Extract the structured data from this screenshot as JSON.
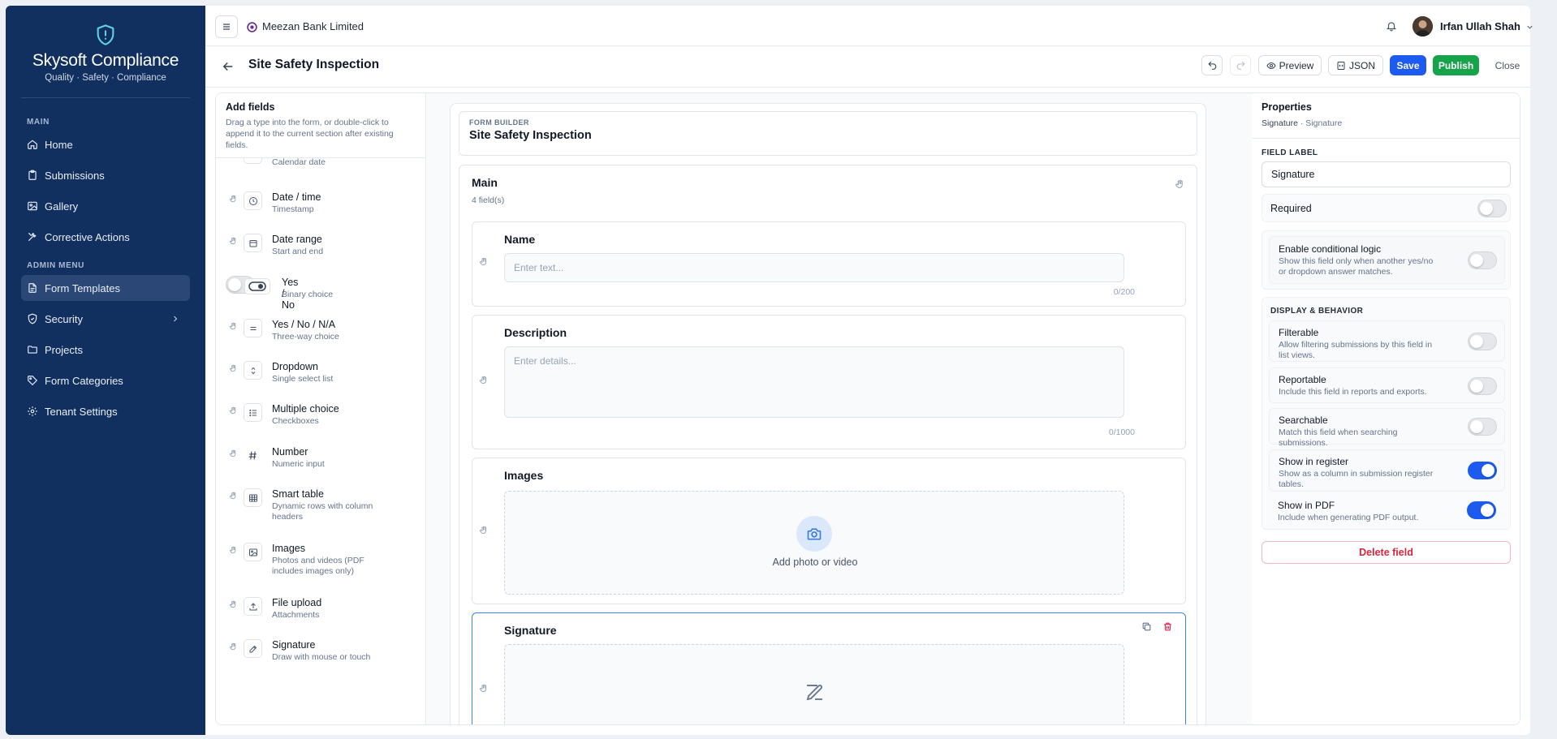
{
  "brand": {
    "title": "Skysoft Compliance",
    "subtitle": "Quality · Safety · Compliance"
  },
  "sidebar": {
    "main_heading": "MAIN",
    "main_items": [
      {
        "label": "Home",
        "icon": "home-icon"
      },
      {
        "label": "Submissions",
        "icon": "clipboard-icon"
      },
      {
        "label": "Gallery",
        "icon": "image-icon"
      },
      {
        "label": "Corrective Actions",
        "icon": "tools-icon"
      }
    ],
    "admin_heading": "ADMIN MENU",
    "admin_items": [
      {
        "label": "Form Templates",
        "icon": "file-icon",
        "active": true
      },
      {
        "label": "Security",
        "icon": "shield-icon",
        "has_submenu": true
      },
      {
        "label": "Projects",
        "icon": "folder-icon"
      },
      {
        "label": "Form Categories",
        "icon": "tag-icon"
      },
      {
        "label": "Tenant Settings",
        "icon": "gear-icon"
      }
    ]
  },
  "topbar": {
    "organization": "Meezan Bank Limited",
    "user_name": "Irfan Ullah Shah"
  },
  "titlebar": {
    "title": "Site Safety Inspection",
    "preview_label": "Preview",
    "json_label": "JSON",
    "save_label": "Save",
    "publish_label": "Publish",
    "close_label": "Close"
  },
  "palette": {
    "title": "Add fields",
    "description": "Drag a type into the form, or double-click to append it to the current section after existing fields.",
    "items": [
      {
        "name": "",
        "desc": "Calendar date",
        "icon": "calendar-icon"
      },
      {
        "name": "Date / time",
        "desc": "Timestamp",
        "icon": "clock-icon"
      },
      {
        "name": "Date range",
        "desc": "Start and end",
        "icon": "calendar-range-icon"
      },
      {
        "name": "Yes / No",
        "desc": "Binary choice",
        "icon": "toggle-icon"
      },
      {
        "name": "Yes / No / N/A",
        "desc": "Three-way choice",
        "icon": "equals-icon"
      },
      {
        "name": "Dropdown",
        "desc": "Single select list",
        "icon": "chevron-updown-icon"
      },
      {
        "name": "Multiple choice",
        "desc": "Checkboxes",
        "icon": "list-icon"
      },
      {
        "name": "Number",
        "desc": "Numeric input",
        "icon": "hash-icon"
      },
      {
        "name": "Smart table",
        "desc": "Dynamic rows with column headers",
        "icon": "table-icon"
      },
      {
        "name": "Images",
        "desc": "Photos and videos (PDF includes images only)",
        "icon": "image-icon"
      },
      {
        "name": "File upload",
        "desc": "Attachments",
        "icon": "upload-icon"
      },
      {
        "name": "Signature",
        "desc": "Draw with mouse or touch",
        "icon": "pen-icon"
      }
    ]
  },
  "builder": {
    "label": "FORM BUILDER",
    "title": "Site Safety Inspection",
    "section": {
      "title": "Main",
      "count": "4 field(s)"
    },
    "fields": {
      "name": {
        "label": "Name",
        "placeholder": "Enter text...",
        "count": "0/200"
      },
      "description": {
        "label": "Description",
        "placeholder": "Enter details...",
        "count": "0/1000"
      },
      "images": {
        "label": "Images",
        "cta": "Add photo or video"
      },
      "signature": {
        "label": "Signature"
      }
    }
  },
  "properties": {
    "title": "Properties",
    "type": "Signature",
    "type_sub": "· Signature",
    "field_label_caption": "FIELD LABEL",
    "field_label_value": "Signature",
    "required_label": "Required",
    "required_on": false,
    "conditional": {
      "title": "Enable conditional logic",
      "desc": "Show this field only when another yes/no or dropdown answer matches.",
      "on": false
    },
    "display_heading": "DISPLAY & BEHAVIOR",
    "options": [
      {
        "name": "Filterable",
        "desc": "Allow filtering submissions by this field in list views.",
        "on": false
      },
      {
        "name": "Reportable",
        "desc": "Include this field in reports and exports.",
        "on": false
      },
      {
        "name": "Searchable",
        "desc": "Match this field when searching submissions.",
        "on": false
      },
      {
        "name": "Show in register",
        "desc": "Show as a column in submission register tables.",
        "on": true
      },
      {
        "name": "Show in PDF",
        "desc": "Include when generating PDF output.",
        "on": true
      }
    ],
    "delete_label": "Delete field"
  },
  "colors": {
    "sidebar_bg": "#12305f",
    "primary": "#1d5bf0",
    "publish": "#16a34a",
    "danger": "#d7263d"
  }
}
